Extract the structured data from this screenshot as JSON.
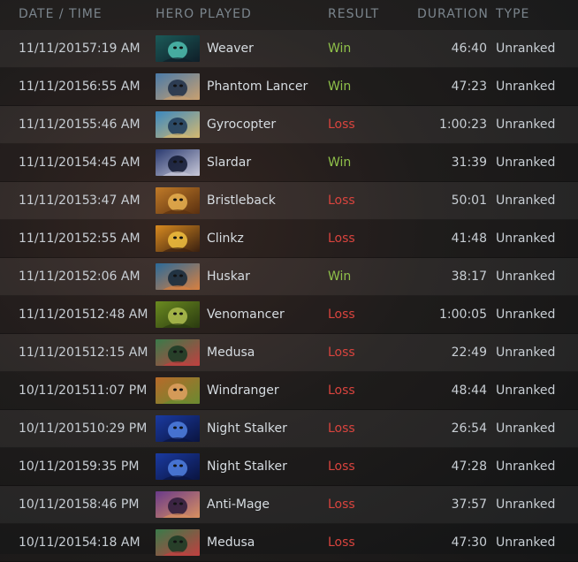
{
  "header": {
    "date_time": "DATE / TIME",
    "hero_played": "HERO PLAYED",
    "result": "RESULT",
    "duration": "DURATION",
    "type": "TYPE"
  },
  "matches": [
    {
      "date": "11/11/2015",
      "time": "7:19 AM",
      "hero": "Weaver",
      "result": "Win",
      "duration": "46:40",
      "type": "Unranked",
      "portrait": "weaver-portrait",
      "colors": [
        "#1b5a58",
        "#0f1e28",
        "#4fc0b0"
      ]
    },
    {
      "date": "11/11/2015",
      "time": "6:55 AM",
      "hero": "Phantom Lancer",
      "result": "Win",
      "duration": "47:23",
      "type": "Unranked",
      "portrait": "phantom-lancer-portrait",
      "colors": [
        "#4a7aa8",
        "#c9a070",
        "#1f2f48"
      ]
    },
    {
      "date": "11/11/2015",
      "time": "5:46 AM",
      "hero": "Gyrocopter",
      "result": "Loss",
      "duration": "1:00:23",
      "type": "Unranked",
      "portrait": "gyrocopter-portrait",
      "colors": [
        "#3a88c0",
        "#d4b870",
        "#1c3a5a"
      ]
    },
    {
      "date": "11/11/2015",
      "time": "4:45 AM",
      "hero": "Slardar",
      "result": "Win",
      "duration": "31:39",
      "type": "Unranked",
      "portrait": "slardar-portrait",
      "colors": [
        "#2a3a70",
        "#c8c8d8",
        "#101830"
      ]
    },
    {
      "date": "11/11/2015",
      "time": "3:47 AM",
      "hero": "Bristleback",
      "result": "Loss",
      "duration": "50:01",
      "type": "Unranked",
      "portrait": "bristleback-portrait",
      "colors": [
        "#c07a28",
        "#5a3010",
        "#e8b050"
      ]
    },
    {
      "date": "11/11/2015",
      "time": "2:55 AM",
      "hero": "Clinkz",
      "result": "Loss",
      "duration": "41:48",
      "type": "Unranked",
      "portrait": "clinkz-portrait",
      "colors": [
        "#d88a20",
        "#3a2010",
        "#f0c040"
      ]
    },
    {
      "date": "11/11/2015",
      "time": "2:06 AM",
      "hero": "Huskar",
      "result": "Win",
      "duration": "38:17",
      "type": "Unranked",
      "portrait": "huskar-portrait",
      "colors": [
        "#2a6a9a",
        "#d88040",
        "#14283a"
      ]
    },
    {
      "date": "11/11/2015",
      "time": "12:48 AM",
      "hero": "Venomancer",
      "result": "Loss",
      "duration": "1:00:05",
      "type": "Unranked",
      "portrait": "venomancer-portrait",
      "colors": [
        "#6a8a20",
        "#2a3a10",
        "#b0c050"
      ]
    },
    {
      "date": "11/11/2015",
      "time": "12:15 AM",
      "hero": "Medusa",
      "result": "Loss",
      "duration": "22:49",
      "type": "Unranked",
      "portrait": "medusa-portrait",
      "colors": [
        "#3a7a4a",
        "#c04040",
        "#183a24"
      ]
    },
    {
      "date": "10/11/2015",
      "time": "11:07 PM",
      "hero": "Windranger",
      "result": "Loss",
      "duration": "48:44",
      "type": "Unranked",
      "portrait": "windranger-portrait",
      "colors": [
        "#b86a2a",
        "#6a8a30",
        "#e0a060"
      ]
    },
    {
      "date": "10/11/2015",
      "time": "10:29 PM",
      "hero": "Night Stalker",
      "result": "Loss",
      "duration": "26:54",
      "type": "Unranked",
      "portrait": "night-stalker-portrait",
      "colors": [
        "#1a3aa0",
        "#0a1440",
        "#5080e0"
      ]
    },
    {
      "date": "10/11/2015",
      "time": "9:35 PM",
      "hero": "Night Stalker",
      "result": "Loss",
      "duration": "47:28",
      "type": "Unranked",
      "portrait": "night-stalker-portrait",
      "colors": [
        "#1a3aa0",
        "#0a1440",
        "#5080e0"
      ]
    },
    {
      "date": "10/11/2015",
      "time": "8:46 PM",
      "hero": "Anti-Mage",
      "result": "Loss",
      "duration": "37:57",
      "type": "Unranked",
      "portrait": "anti-mage-portrait",
      "colors": [
        "#6a3a8a",
        "#d89060",
        "#2a1a3a"
      ]
    },
    {
      "date": "10/11/2015",
      "time": "4:18 AM",
      "hero": "Medusa",
      "result": "Loss",
      "duration": "47:30",
      "type": "Unranked",
      "portrait": "medusa-portrait",
      "colors": [
        "#3a7a4a",
        "#c04040",
        "#183a24"
      ]
    }
  ]
}
